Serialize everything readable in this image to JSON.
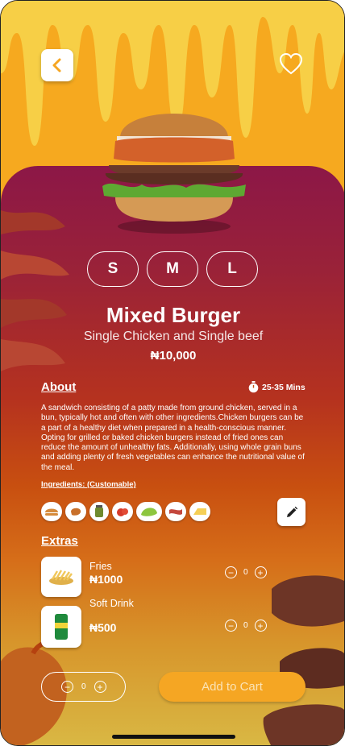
{
  "product": {
    "title": "Mixed Burger",
    "subtitle": "Single Chicken and Single beef",
    "price": "₦10,000",
    "sizes": [
      "S",
      "M",
      "L"
    ]
  },
  "about": {
    "heading": "About",
    "time": "25-35 Mins",
    "description": "A sandwich consisting of a patty made from ground chicken, served in a bun, typically hot and often with other ingredients.Chicken burgers can be a part of a healthy diet when prepared in a health-conscious manner. Opting for grilled or baked chicken burgers instead of fried ones can reduce the amount of unhealthy fats. Additionally, using whole grain buns and adding plenty of fresh vegetables can enhance the nutritional value of the meal."
  },
  "ingredients": {
    "heading": "Ingredients: (Customable)",
    "items": [
      "bun-icon",
      "chicken-icon",
      "pickle-jar-icon",
      "tomato-icon",
      "lettuce-icon",
      "bacon-icon",
      "cheese-icon"
    ]
  },
  "extras": {
    "heading": "Extras",
    "items": [
      {
        "name": "Fries",
        "price": "₦1000",
        "qty": "0"
      },
      {
        "name": "Soft Drink",
        "price": "₦500",
        "qty": "0"
      }
    ]
  },
  "footer": {
    "qty": "0",
    "add_to_cart": "Add to Cart"
  },
  "colors": {
    "accent": "#f5a623",
    "card_top": "#8c1747",
    "card_bottom": "#d9b844"
  }
}
